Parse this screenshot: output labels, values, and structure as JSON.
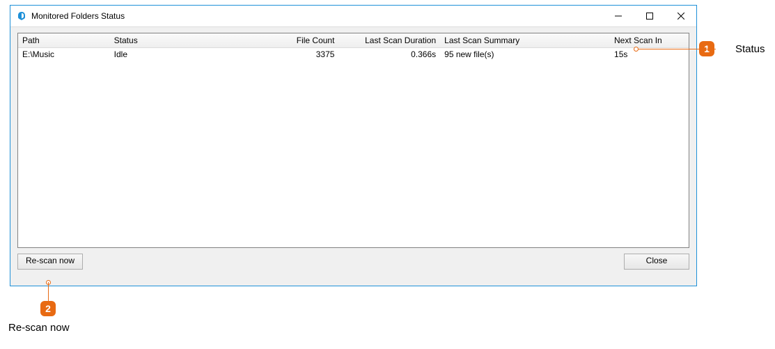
{
  "window": {
    "title": "Monitored Folders Status"
  },
  "table": {
    "headers": {
      "path": "Path",
      "status": "Status",
      "file_count": "File Count",
      "last_scan_duration": "Last Scan Duration",
      "last_scan_summary": "Last Scan Summary",
      "next_scan_in": "Next Scan In"
    },
    "rows": [
      {
        "path": "E:\\Music",
        "status": "Idle",
        "file_count": "3375",
        "last_scan_duration": "0.366s",
        "last_scan_summary": "95 new file(s)",
        "next_scan_in": "15s"
      }
    ]
  },
  "buttons": {
    "rescan": "Re-scan now",
    "close": "Close"
  },
  "callouts": {
    "one": {
      "num": "1",
      "label": "Status"
    },
    "two": {
      "num": "2",
      "label": "Re-scan now"
    }
  }
}
